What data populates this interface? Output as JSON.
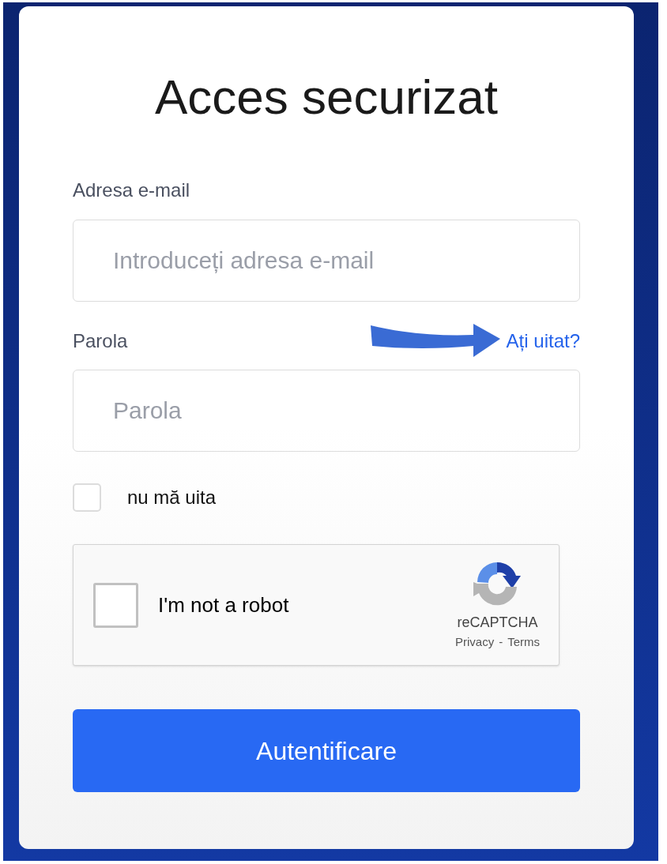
{
  "title": "Acces securizat",
  "email": {
    "label": "Adresa e-mail",
    "placeholder": "Introduceți adresa e-mail"
  },
  "password": {
    "label": "Parola",
    "placeholder": "Parola",
    "forgot_link": "Ați uitat?"
  },
  "remember": {
    "label": "nu mă uita",
    "checked": false
  },
  "captcha": {
    "label": "I'm not a robot",
    "checked": false,
    "brand": "reCAPTCHA",
    "privacy": "Privacy",
    "separator": "-",
    "terms": "Terms"
  },
  "submit": {
    "label": "Autentificare"
  }
}
